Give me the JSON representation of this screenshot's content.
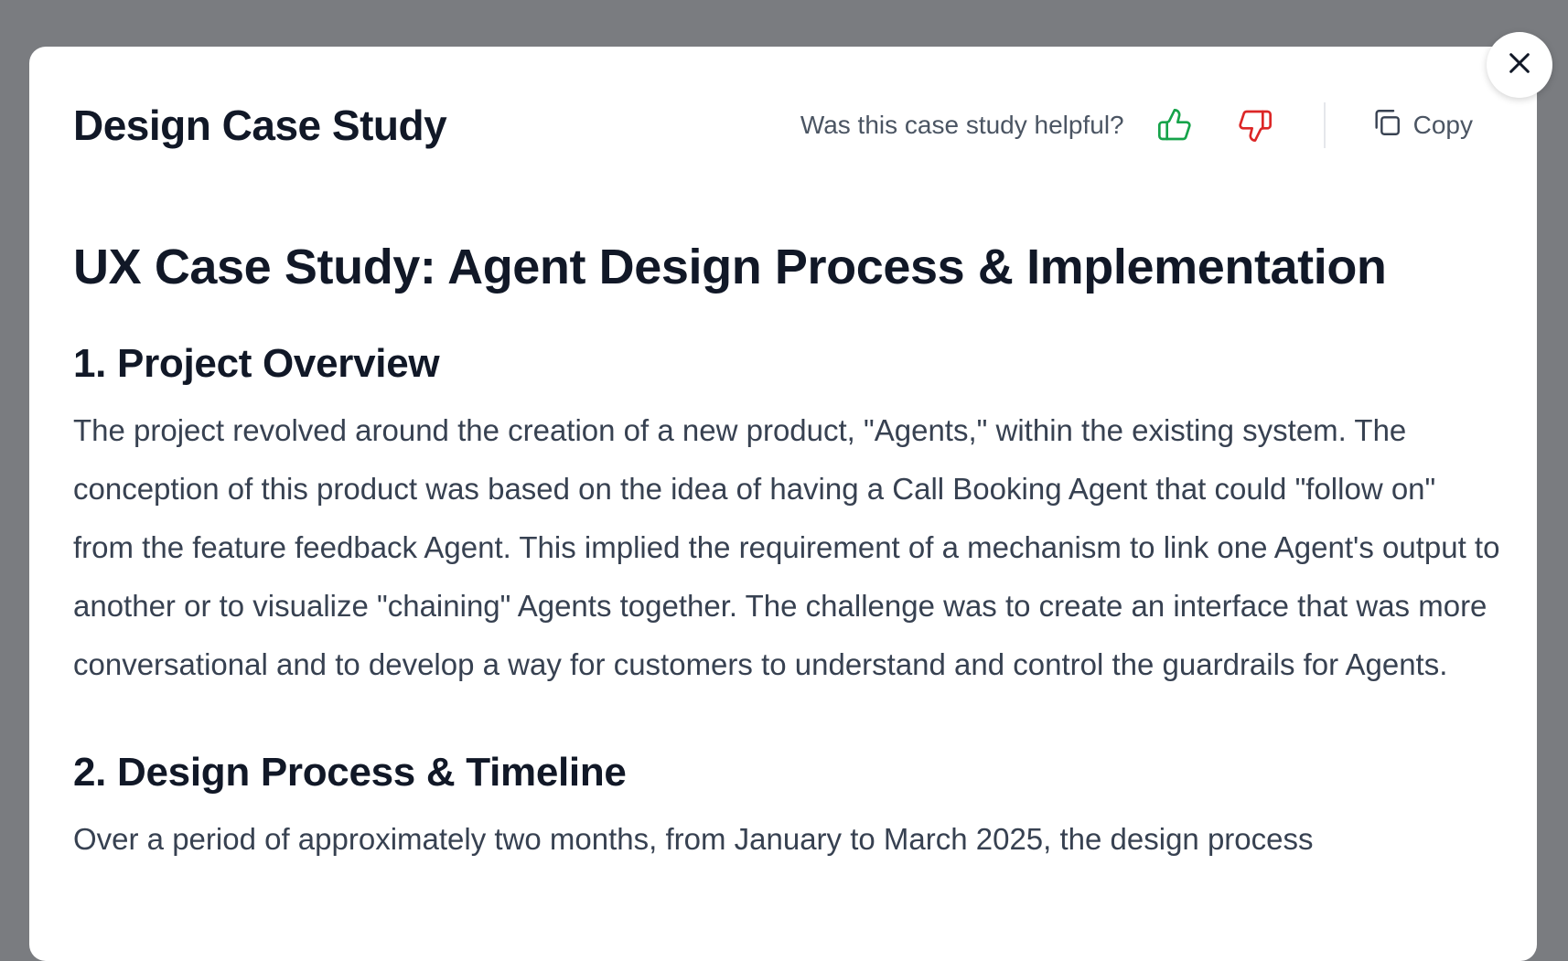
{
  "modal": {
    "title": "Design Case Study",
    "feedback_prompt": "Was this case study helpful?",
    "copy_label": "Copy"
  },
  "icons": {
    "thumbs_up": "thumbs-up-icon",
    "thumbs_down": "thumbs-down-icon",
    "copy": "copy-icon",
    "close": "close-icon"
  },
  "colors": {
    "thumbs_up": "#16a34a",
    "thumbs_down": "#dc2626",
    "heading": "#111827",
    "body_text": "#374151",
    "overlay": "#7a7c80"
  },
  "document": {
    "title": "UX Case Study: Agent Design Process & Implementation",
    "sections": [
      {
        "heading": "1. Project Overview",
        "body": "The project revolved around the creation of a new product, \"Agents,\" within the existing system. The conception of this product was based on the idea of having a Call Booking Agent that could \"follow on\" from the feature feedback Agent. This implied the requirement of a mechanism to link one Agent's output to another or to visualize \"chaining\" Agents together. The challenge was to create an interface that was more conversational and to develop a way for customers to understand and control the guardrails for Agents."
      },
      {
        "heading": "2. Design Process & Timeline",
        "body": "Over a period of approximately two months, from January to March 2025, the design process"
      }
    ]
  }
}
